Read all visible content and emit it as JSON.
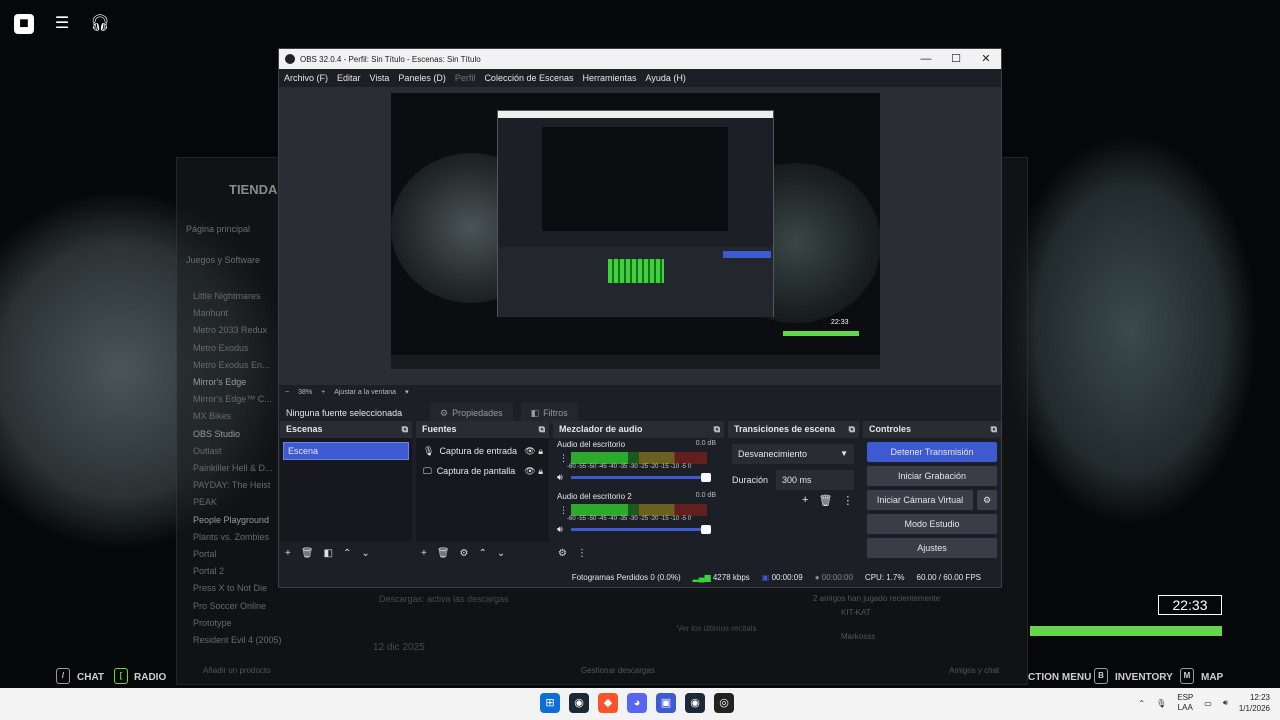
{
  "game": {
    "top_icons": [
      "roblox-icon",
      "menu-icon",
      "headset-icon"
    ],
    "store_title": "TIENDA",
    "store_nav": [
      "Página principal",
      "Juegos y Software"
    ],
    "games": [
      "Little Nightmares",
      "Manhunt",
      "Metro 2033 Redux",
      "Metro Exodus",
      "Metro Exodus En...",
      "Mirror's Edge",
      "Mirror's Edge™ C...",
      "MX Bikes",
      "OBS Studio",
      "Outlast",
      "Painkiller Hell & D...",
      "PAYDAY: The Heist",
      "PEAK",
      "People Playground",
      "Plants vs. Zombies",
      "Portal",
      "Portal 2",
      "Press X to Not Die",
      "Pro Soccer Online",
      "Prototype",
      "Resident Evil 4 (2005)"
    ],
    "store_bottom": "Añadir un producto",
    "store_date": "12 dic 2025",
    "store_mid1": "Descargas: activa las descargas",
    "store_mid2": "Ver los últimos recitals",
    "store_friends": "2 amigos han jugado recientemente",
    "friend1": "KIT-KAT",
    "friend2": "Markosss",
    "store_downloads": "Gestionar descargas",
    "store_chat": "Amigos y chat",
    "hud_time": "22:33",
    "hud": [
      {
        "key": "/",
        "label": "CHAT"
      },
      {
        "key": "[",
        "label": "RADIO"
      },
      {
        "key": "",
        "label": "CTION MENU"
      },
      {
        "key": "B",
        "label": "INVENTORY"
      },
      {
        "key": "M",
        "label": "MAP"
      }
    ]
  },
  "obs": {
    "title": "OBS 32.0.4 - Perfil: Sin Título - Escenas: Sin Título",
    "menu": [
      "Archivo (F)",
      "Editar",
      "Vista",
      "Paneles (D)",
      "Perfil",
      "Colección de Escenas",
      "Herramientas",
      "Ayuda (H)"
    ],
    "preview_time": "22:33",
    "zoom": "38%",
    "fit": "Ajustar a la ventana",
    "no_source": "Ninguna fuente seleccionada",
    "props": "Propiedades",
    "filters": "Filtros",
    "scenes_title": "Escenas",
    "scene": "Escena",
    "sources_title": "Fuentes",
    "sources": [
      "Captura de entrada",
      "Captura de pantalla"
    ],
    "mixer_title": "Mezclador de audio",
    "mixer": [
      {
        "name": "Audio del escritorio",
        "db": "0.0 dB"
      },
      {
        "name": "Audio del escritorio 2",
        "db": "0.0 dB"
      }
    ],
    "scale": "-60 -55 -50 -45 -40 -35 -30 -25 -20 -15 -10 -5 0",
    "transitions_title": "Transiciones de escena",
    "transition": "Desvanecimiento",
    "duration_label": "Duración",
    "duration": "300 ms",
    "controls_title": "Controles",
    "controls": {
      "stream": "Detener Transmisión",
      "record": "Iniciar Grabación",
      "vcam": "Iniciar Cámara Virtual",
      "studio": "Modo Estudio",
      "settings": "Ajustes"
    },
    "status": {
      "dropped": "Fotogramas Perdidos 0 (0.0%)",
      "kbps": "4278 kbps",
      "stream_time": "00:00:09",
      "rec_time": "00:00:00",
      "cpu": "CPU: 1.7%",
      "fps": "60.00 / 60.00 FPS"
    }
  },
  "taskbar": {
    "lang1": "ESP",
    "lang2": "LAA",
    "time": "12:23",
    "date": "1/1/2026"
  }
}
